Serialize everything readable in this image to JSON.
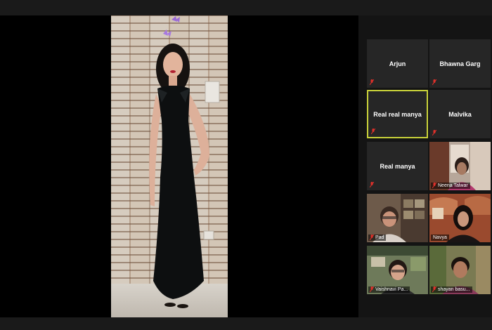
{
  "participants": [
    {
      "name": "Arjun",
      "video": false,
      "muted": true
    },
    {
      "name": "Bhawna Garg",
      "video": false,
      "muted": true
    },
    {
      "name": "Real real manya",
      "video": false,
      "muted": true,
      "active_speaker": true
    },
    {
      "name": "Malvika",
      "video": false,
      "muted": true
    },
    {
      "name": "Real manya",
      "video": false,
      "muted": true
    },
    {
      "name": "Neena Talwar",
      "video": true,
      "muted": true
    },
    {
      "name": "Pad",
      "video": true,
      "muted": true
    },
    {
      "name": "Navya",
      "video": true,
      "muted": false
    },
    {
      "name": "Vaishnavi Pa...",
      "video": true,
      "muted": true
    },
    {
      "name": "shayan basu...",
      "video": true,
      "muted": true
    }
  ],
  "colors": {
    "active_border": "#c9d23a",
    "muted_icon": "#e0302a",
    "tile_bg": "#262626"
  },
  "icons": {
    "muted": "mic-muted-icon"
  }
}
